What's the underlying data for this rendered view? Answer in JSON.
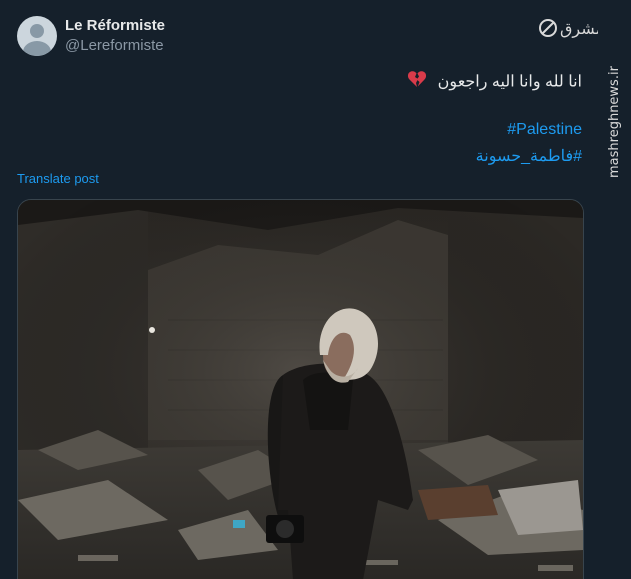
{
  "author": {
    "name": "Le Réformiste",
    "handle": "@Lereformiste"
  },
  "tweet": {
    "text": "انا لله وانا اليه راجعون",
    "emoji": "broken-heart-icon",
    "hashtags": [
      "#Palestine",
      "#فاطمة_حسونة"
    ]
  },
  "translate_label": "Translate post",
  "watermark": {
    "logo_text": "مشرق",
    "site_text": "mashreghnews.ir"
  },
  "colors": {
    "background": "#15202b",
    "link": "#1d9bf0",
    "text": "#e7e9ea",
    "muted": "#8b98a5"
  }
}
